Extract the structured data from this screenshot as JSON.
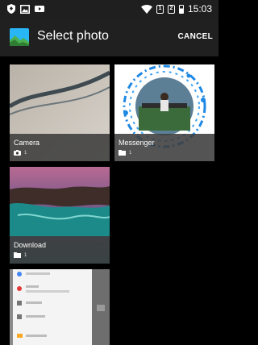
{
  "status_bar": {
    "time": "15:03",
    "sim_1": "1",
    "sim_2": "2",
    "left_icons": [
      "shield-icon",
      "image-icon",
      "video-icon"
    ],
    "right_icons": [
      "wifi-icon",
      "sim-icon",
      "sim-icon",
      "battery-icon"
    ]
  },
  "app_bar": {
    "title": "Select photo",
    "cancel_label": "CANCEL",
    "icon": "gallery-icon"
  },
  "albums": [
    {
      "name": "Camera",
      "count": "1",
      "icon": "camera-icon"
    },
    {
      "name": "Messenger",
      "count": "1",
      "icon": "folder-icon"
    },
    {
      "name": "Download",
      "count": "1",
      "icon": "folder-icon"
    },
    {
      "name": "",
      "count": "",
      "icon": ""
    }
  ],
  "colors": {
    "app_bar_bg": "#202020",
    "status_bar_bg": "#1f1f1f",
    "background": "#000000",
    "caption_bg": "#3c3c3c",
    "messenger_blue": "#1e88e5",
    "gallery_icon_blue": "#29b6f6",
    "gallery_icon_green": "#4caf50"
  }
}
